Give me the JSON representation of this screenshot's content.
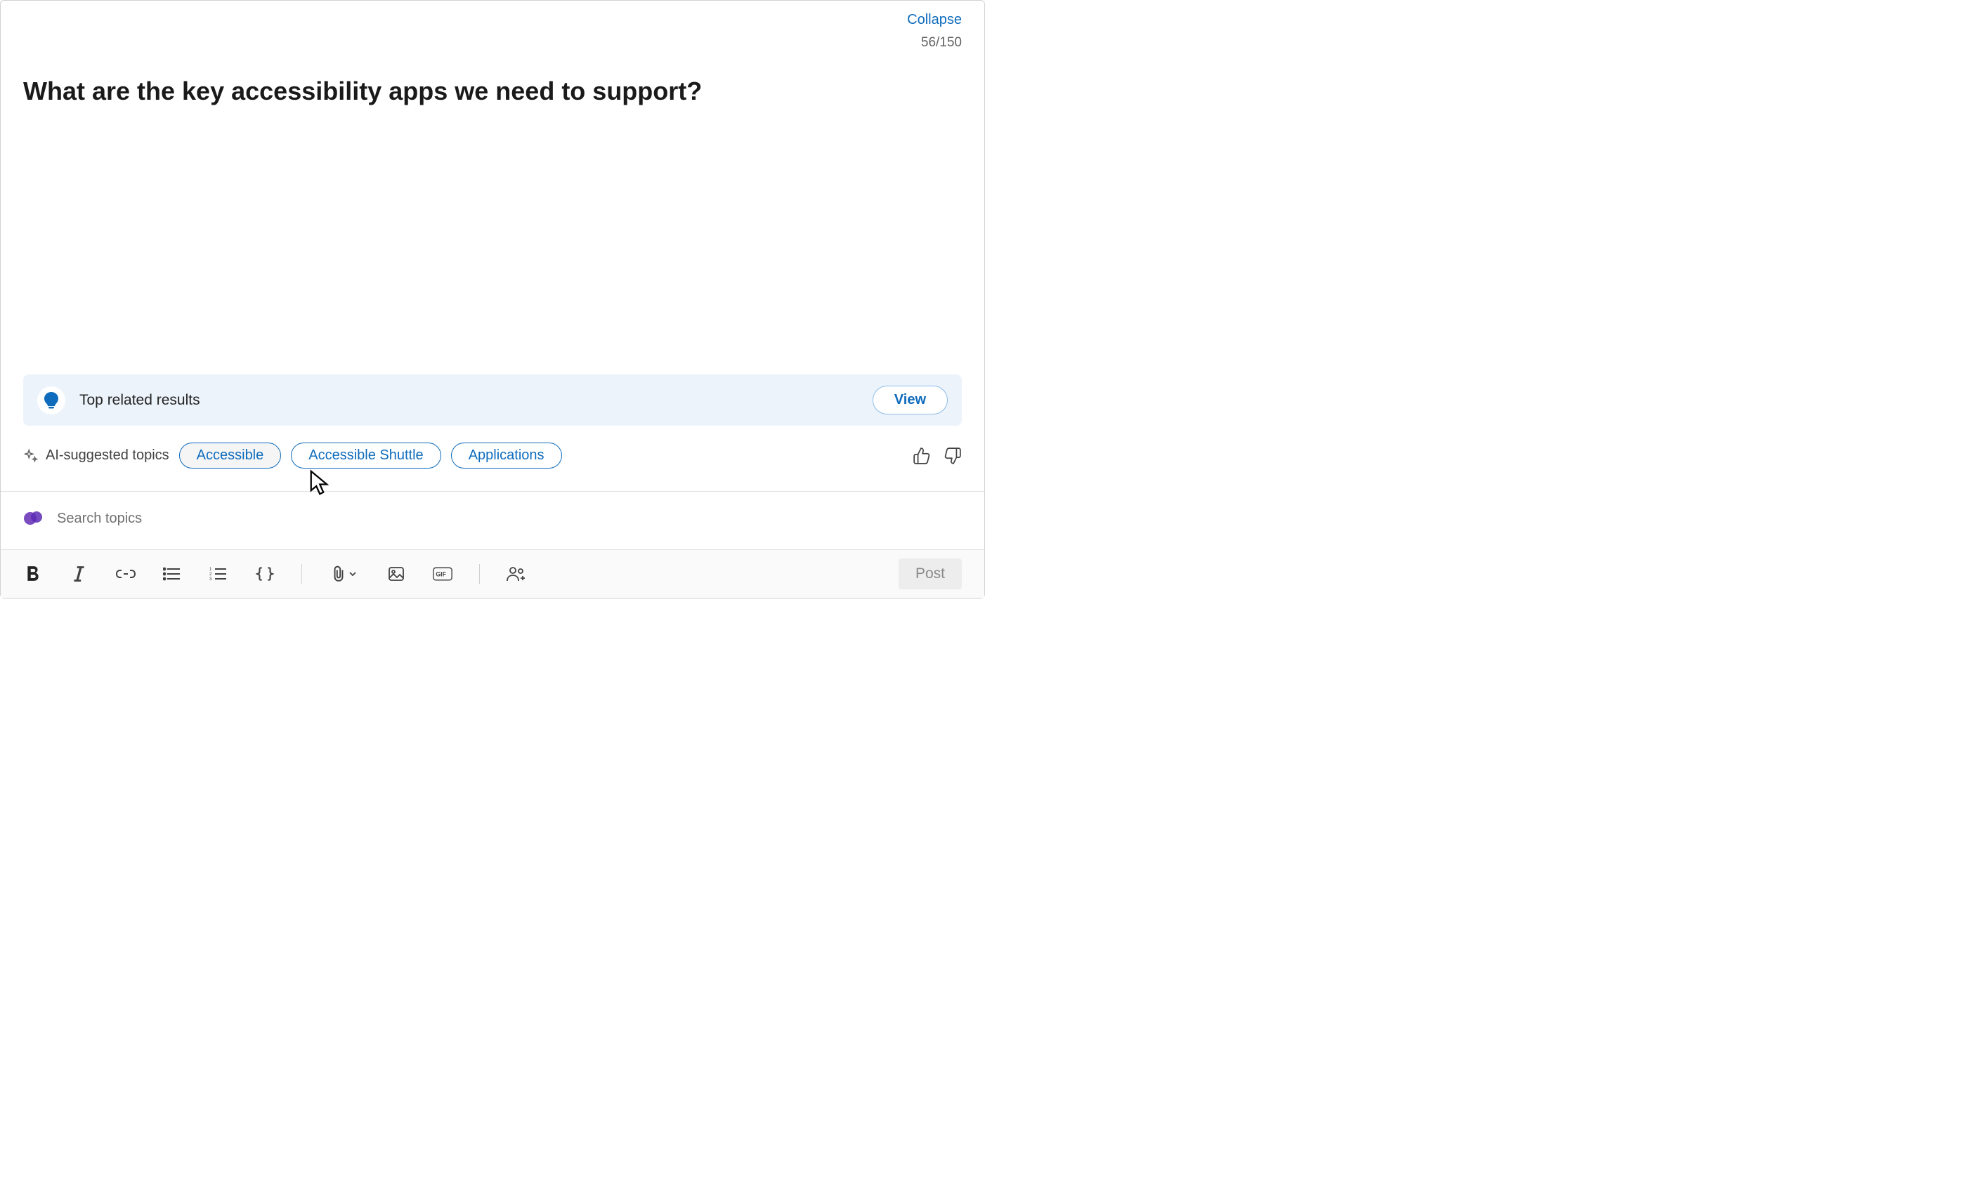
{
  "header": {
    "collapse_label": "Collapse",
    "char_count": "56/150",
    "title": "What are the key accessibility apps we need to support?"
  },
  "related": {
    "label": "Top related results",
    "view_label": "View"
  },
  "ai_topics": {
    "label": "AI-suggested topics",
    "pills": [
      "Accessible",
      "Accessible Shuttle",
      "Applications"
    ]
  },
  "search": {
    "placeholder": "Search topics"
  },
  "toolbar": {
    "post_label": "Post"
  }
}
